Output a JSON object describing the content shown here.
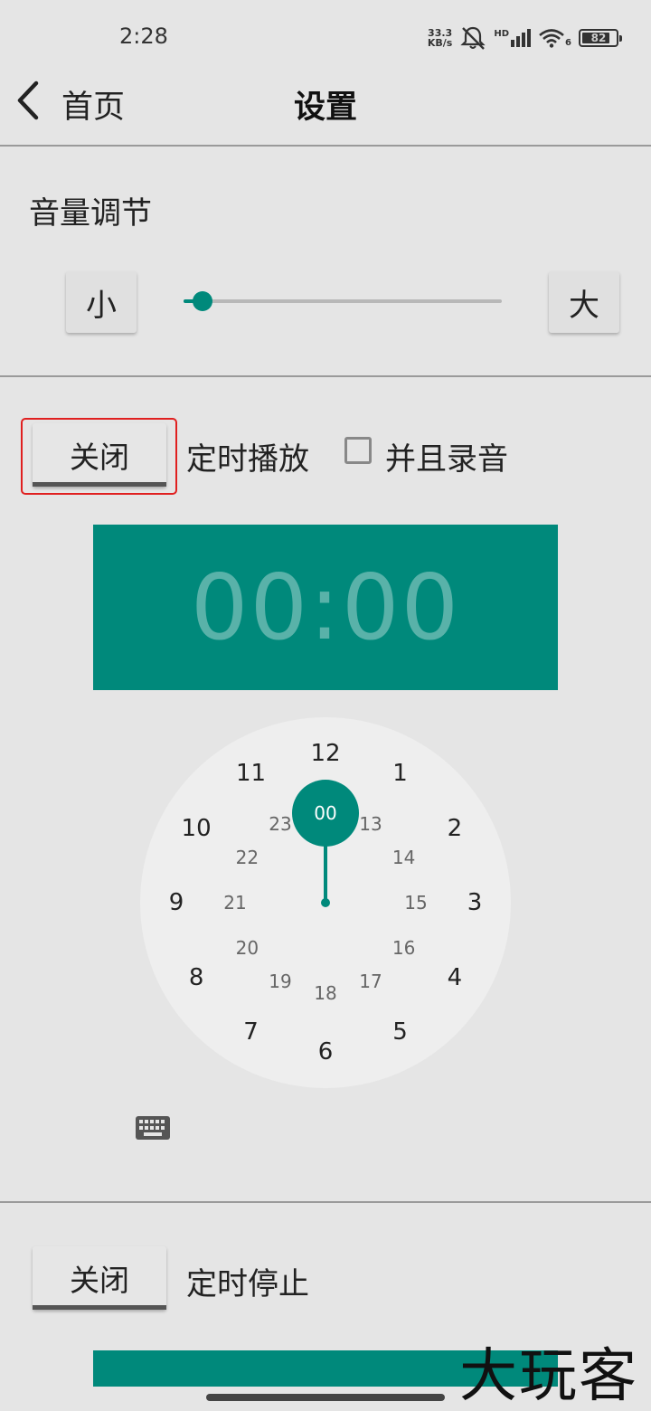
{
  "status_bar": {
    "time": "2:28",
    "net_speed_value": "33.3",
    "net_speed_unit": "KB/s",
    "signal_label": "HD",
    "wifi_label": "6",
    "battery_level": "82",
    "battery_fraction": 0.82
  },
  "toolbar": {
    "back_label": "首页",
    "title": "设置"
  },
  "volume": {
    "section_title": "音量调节",
    "decrease_label": "小",
    "increase_label": "大",
    "level_fraction": 0.06
  },
  "scheduled_play": {
    "toggle_label": "关闭",
    "label": "定时播放",
    "record_label": "并且录音",
    "record_checked": false,
    "time_display": "00:00"
  },
  "clock": {
    "selected_value": "00",
    "outer_numbers": [
      "12",
      "1",
      "2",
      "3",
      "4",
      "5",
      "6",
      "7",
      "8",
      "9",
      "10",
      "11"
    ],
    "inner_numbers": [
      "13",
      "14",
      "15",
      "16",
      "17",
      "18",
      "19",
      "20",
      "21",
      "22",
      "23"
    ]
  },
  "scheduled_stop": {
    "toggle_label": "关闭",
    "label": "定时停止"
  },
  "watermark": "大玩客",
  "colors": {
    "accent": "#00897b",
    "background": "#e5e5e5",
    "highlight": "#e02020"
  }
}
